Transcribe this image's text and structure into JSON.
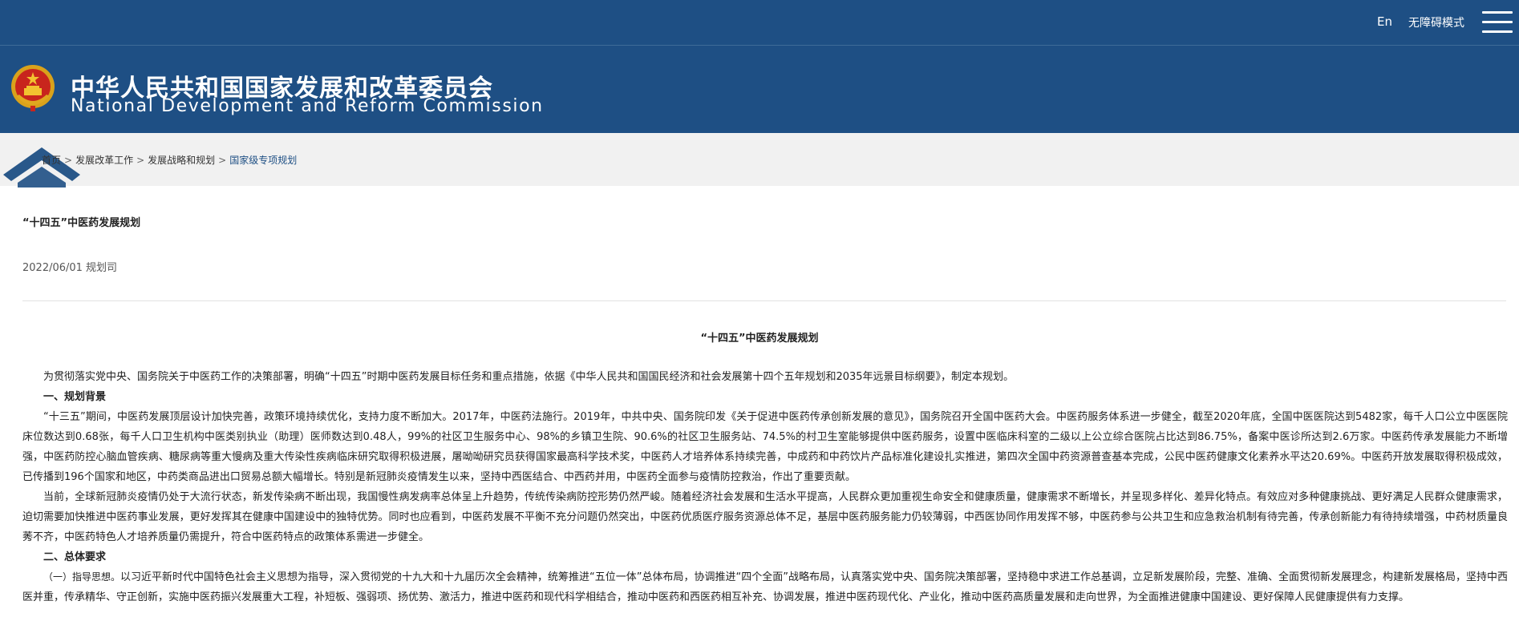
{
  "topbar": {
    "lang_label": "En",
    "accessibility_label": "无障碍模式",
    "menu_icon": "hamburger-menu-icon"
  },
  "banner": {
    "emblem_icon": "national-emblem-icon",
    "title_zh": "中华人民共和国国家发展和改革委员会",
    "title_en": "National Development and Reform Commission",
    "color": "#1e4f84"
  },
  "breadcrumb": {
    "home_icon": "home-icon",
    "items": [
      "首页",
      "发展改革工作",
      "发展战略和规划",
      "国家级专项规划"
    ],
    "separator": ">"
  },
  "article": {
    "title": "“十四五”中医药发展规划",
    "date": "2022/06/01",
    "source": "规划司",
    "doc_heading": "“十四五”中医药发展规划",
    "paragraphs": [
      {
        "type": "p",
        "text": "为贯彻落实党中央、国务院关于中医药工作的决策部署，明确“十四五”时期中医药发展目标任务和重点措施，依据《中华人民共和国国民经济和社会发展第十四个五年规划和2035年远景目标纲要》，制定本规划。"
      },
      {
        "type": "h",
        "text": "一、规划背景"
      },
      {
        "type": "p",
        "text": "“十三五”期间，中医药发展顶层设计加快完善，政策环境持续优化，支持力度不断加大。2017年，中医药法施行。2019年，中共中央、国务院印发《关于促进中医药传承创新发展的意见》，国务院召开全国中医药大会。中医药服务体系进一步健全，截至2020年底，全国中医医院达到5482家，每千人口公立中医医院床位数达到0.68张，每千人口卫生机构中医类别执业（助理）医师数达到0.48人，99%的社区卫生服务中心、98%的乡镇卫生院、90.6%的社区卫生服务站、74.5%的村卫生室能够提供中医药服务，设置中医临床科室的二级以上公立综合医院占比达到86.75%，备案中医诊所达到2.6万家。中医药传承发展能力不断增强，中医药防控心脑血管疾病、糖尿病等重大慢病及重大传染性疾病临床研究取得积极进展，屠呦呦研究员获得国家最高科学技术奖，中医药人才培养体系持续完善，中成药和中药饮片产品标准化建设扎实推进，第四次全国中药资源普查基本完成，公民中医药健康文化素养水平达20.69%。中医药开放发展取得积极成效，已传播到196个国家和地区，中药类商品进出口贸易总额大幅增长。特别是新冠肺炎疫情发生以来，坚持中西医结合、中西药并用，中医药全面参与疫情防控救治，作出了重要贡献。"
      },
      {
        "type": "p",
        "text": "当前，全球新冠肺炎疫情仍处于大流行状态，新发传染病不断出现，我国慢性病发病率总体呈上升趋势，传统传染病防控形势仍然严峻。随着经济社会发展和生活水平提高，人民群众更加重视生命安全和健康质量，健康需求不断增长，并呈现多样化、差异化特点。有效应对多种健康挑战、更好满足人民群众健康需求，迫切需要加快推进中医药事业发展，更好发挥其在健康中国建设中的独特优势。同时也应看到，中医药发展不平衡不充分问题仍然突出，中医药优质医疗服务资源总体不足，基层中医药服务能力仍较薄弱，中西医协同作用发挥不够，中医药参与公共卫生和应急救治机制有待完善，传承创新能力有待持续增强，中药材质量良莠不齐，中医药特色人才培养质量仍需提升，符合中医药特点的政策体系需进一步健全。"
      },
      {
        "type": "h",
        "text": "二、总体要求"
      },
      {
        "type": "p",
        "lead": "（一）指导思想。",
        "text": "以习近平新时代中国特色社会主义思想为指导，深入贯彻党的十九大和十九届历次全会精神，统筹推进“五位一体”总体布局，协调推进“四个全面”战略布局，认真落实党中央、国务院决策部署，坚持稳中求进工作总基调，立足新发展阶段，完整、准确、全面贯彻新发展理念，构建新发展格局，坚持中西医并重，传承精华、守正创新，实施中医药振兴发展重大工程，补短板、强弱项、扬优势、激活力，推进中医药和现代科学相结合，推动中医药和西医药相互补充、协调发展，推进中医药现代化、产业化，推动中医药高质量发展和走向世界，为全面推进健康中国建设、更好保障人民健康提供有力支撑。"
      }
    ]
  }
}
